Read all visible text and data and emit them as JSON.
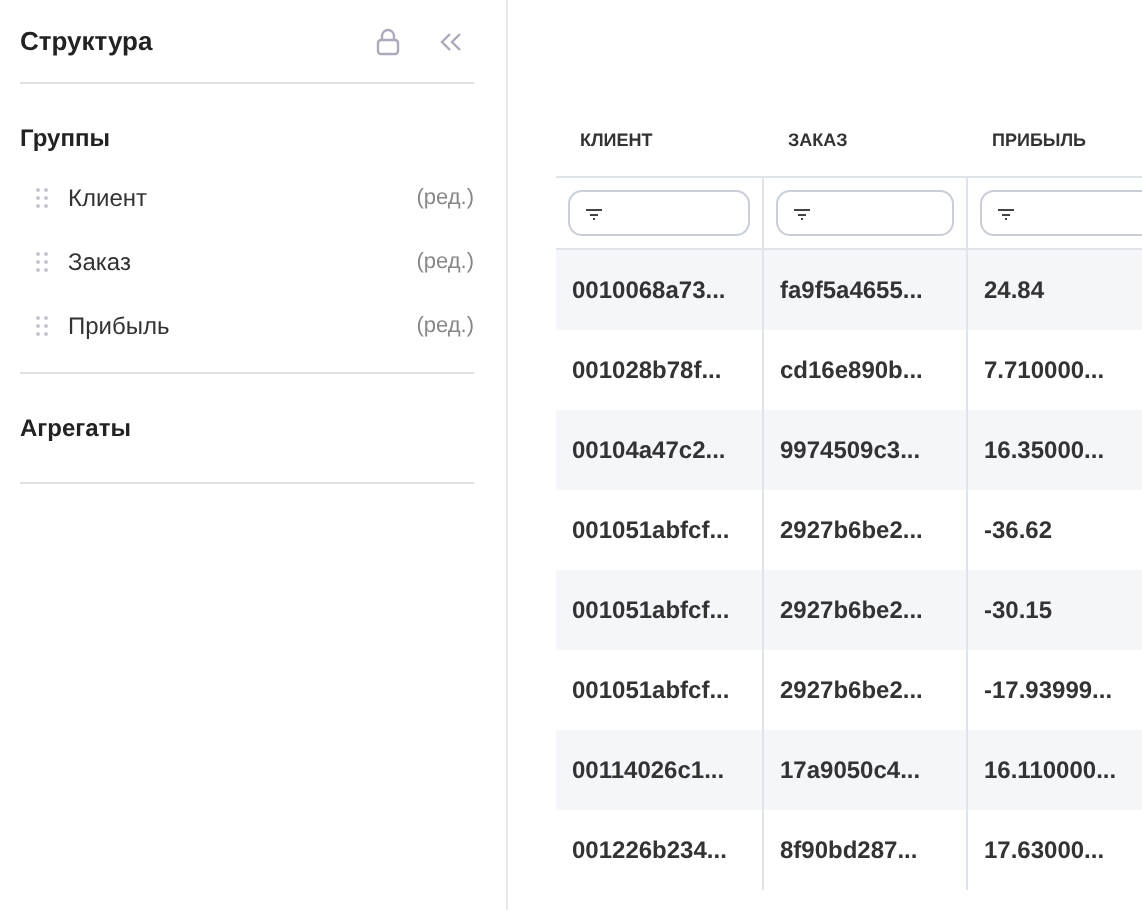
{
  "sidebar": {
    "title": "Структура",
    "groups_heading": "Группы",
    "groups": [
      {
        "label": "Клиент",
        "action": "(ред.)"
      },
      {
        "label": "Заказ",
        "action": "(ред.)"
      },
      {
        "label": "Прибыль",
        "action": "(ред.)"
      }
    ],
    "aggregates_heading": "Агрегаты"
  },
  "table": {
    "columns": [
      "КЛИЕНТ",
      "ЗАКАЗ",
      "ПРИБЫЛЬ"
    ],
    "rows": [
      [
        "0010068a73...",
        "fa9f5a4655...",
        "24.84"
      ],
      [
        "001028b78f...",
        "cd16e890b...",
        "7.710000..."
      ],
      [
        "00104a47c2...",
        "9974509c3...",
        "16.35000..."
      ],
      [
        "001051abfcf...",
        "2927b6be2...",
        "-36.62"
      ],
      [
        "001051abfcf...",
        "2927b6be2...",
        "-30.15"
      ],
      [
        "001051abfcf...",
        "2927b6be2...",
        "-17.93999..."
      ],
      [
        "00114026c1...",
        "17a9050c4...",
        "16.110000..."
      ],
      [
        "001226b234...",
        "8f90bd287...",
        "17.63000..."
      ]
    ]
  }
}
